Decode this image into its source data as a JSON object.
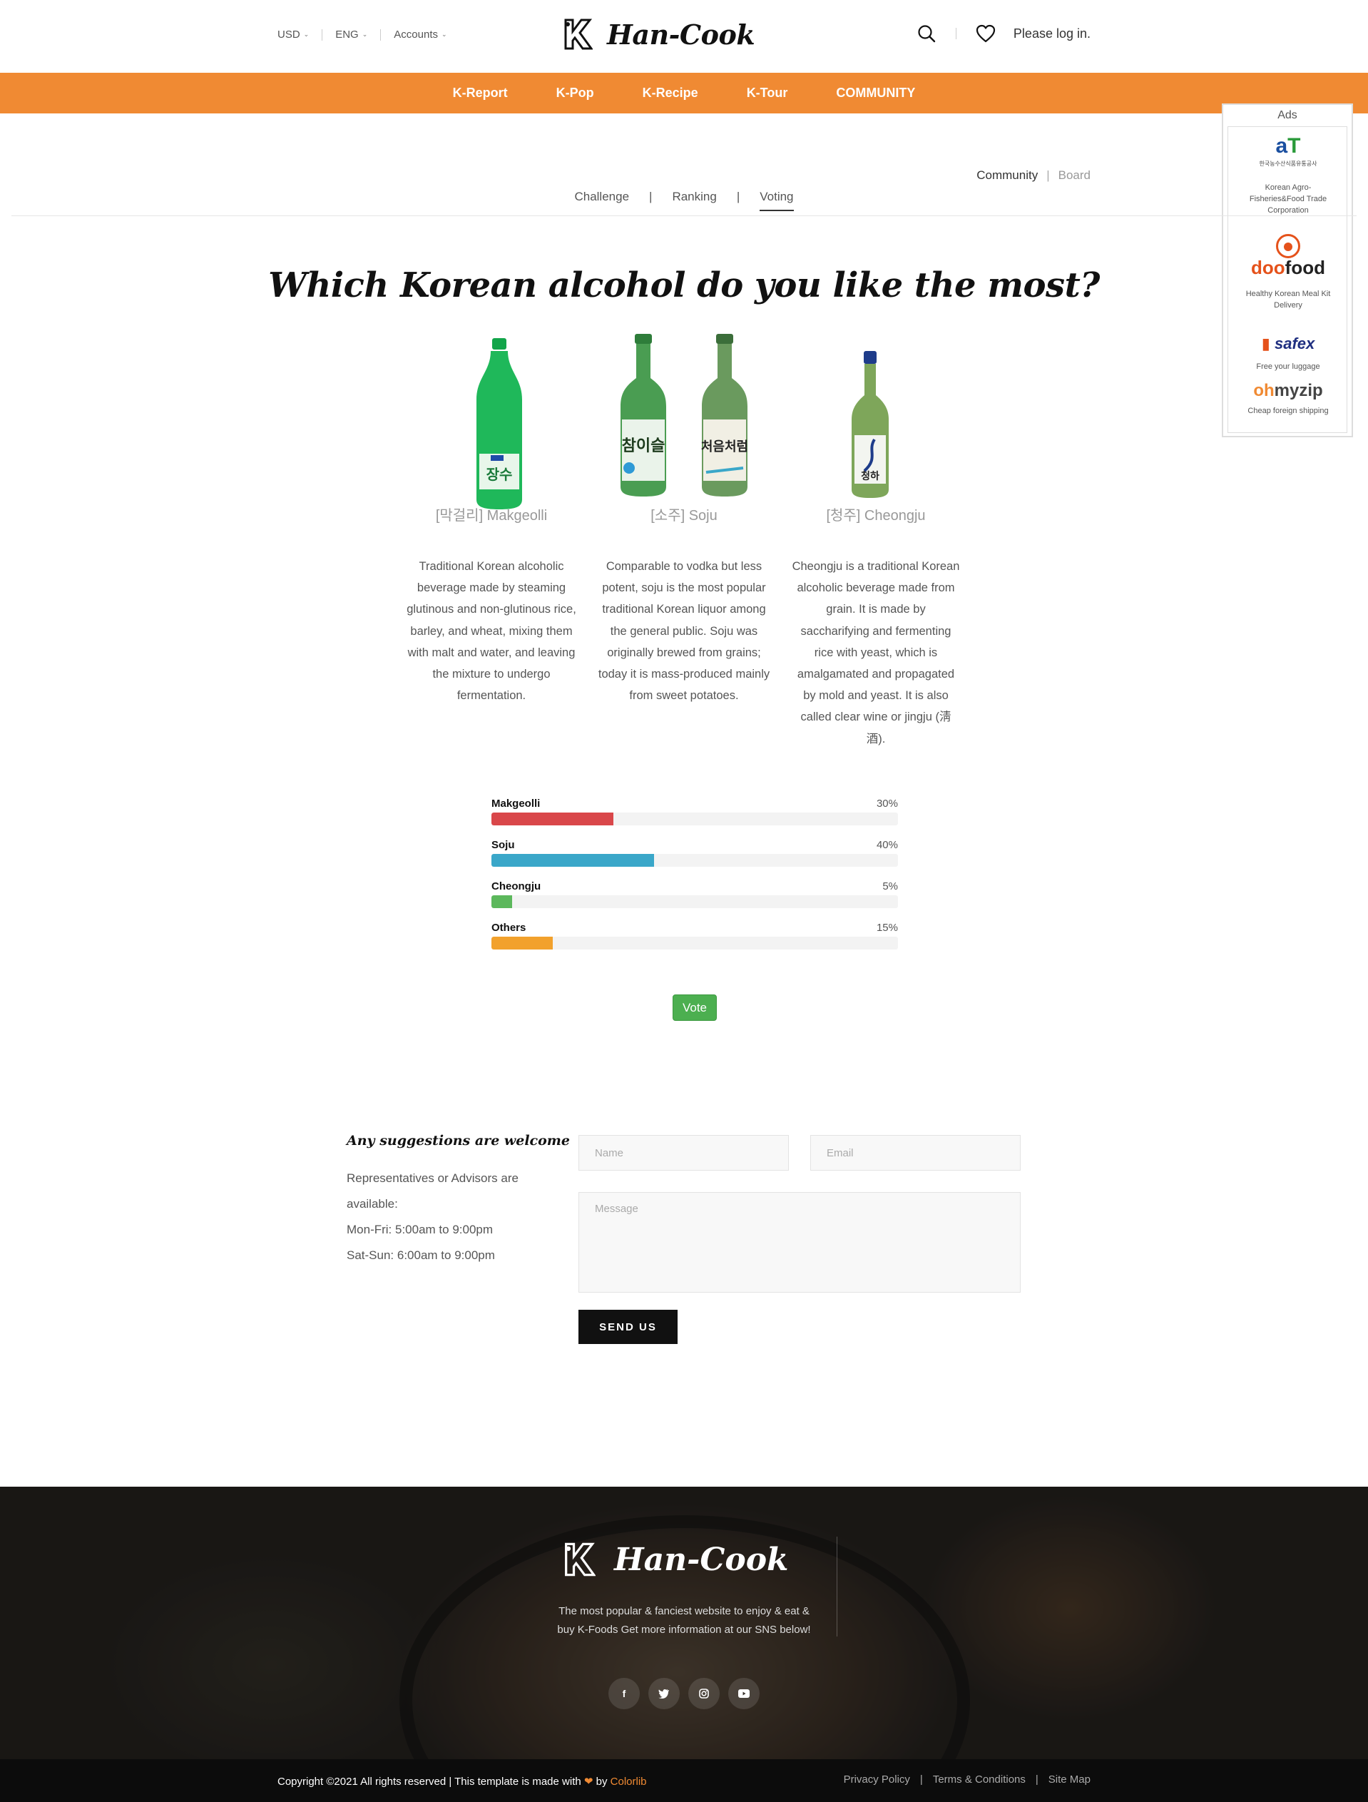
{
  "topbar": {
    "currency": "USD",
    "language": "ENG",
    "accounts": "Accounts",
    "login": "Please log in."
  },
  "brand": {
    "name": "Han-Cook",
    "accent": "#f08a33"
  },
  "nav": [
    "K-Report",
    "K-Pop",
    "K-Recipe",
    "K-Tour",
    "COMMUNITY"
  ],
  "ads": {
    "title": "Ads",
    "items": [
      {
        "logo": "aT",
        "sub": "한국농수산식품유통공사",
        "caption": "Korean Agro-Fisheries&Food Trade Corporation"
      },
      {
        "logo": "doofood",
        "caption": "Healthy Korean Meal Kit Delivery"
      },
      {
        "logo": "safex",
        "caption": "Free your luggage"
      },
      {
        "logo": "ohmyzip",
        "caption": "Cheap foreign shipping"
      }
    ]
  },
  "breadcrumb": {
    "items": [
      "Community",
      "Board"
    ]
  },
  "subnav": {
    "items": [
      "Challenge",
      "Ranking",
      "Voting"
    ],
    "active": "Voting"
  },
  "poll": {
    "question": "Which Korean alcohol do you like the most?",
    "drinks": [
      {
        "label": "[막걸리] Makgeolli",
        "bottle_text": "장수",
        "desc": "Traditional Korean alcoholic beverage made by steaming glutinous and non-glutinous rice, barley, and wheat, mixing them with malt and water, and leaving the mixture to undergo fermentation."
      },
      {
        "label": "[소주] Soju",
        "bottle_text": [
          "참이슬",
          "처음처럼"
        ],
        "desc": "Comparable to vodka but less potent, soju is the most popular traditional Korean liquor among the general public. Soju was originally brewed from grains; today it is mass-produced mainly from sweet potatoes."
      },
      {
        "label": "[청주] Cheongju",
        "bottle_text": "청하",
        "desc": "Cheongju is a traditional Korean alcoholic beverage made from grain. It is made by saccharifying and fermenting rice with yeast, which is amalgamated and propagated by mold and yeast. It is also called clear wine or jingju (淸酒)."
      }
    ],
    "results": [
      {
        "name": "Makgeolli",
        "percent": "30%",
        "value": 30,
        "color": "#d9474a"
      },
      {
        "name": "Soju",
        "percent": "40%",
        "value": 40,
        "color": "#3aa7c9"
      },
      {
        "name": "Cheongju",
        "percent": "5%",
        "value": 5,
        "color": "#5cb85c"
      },
      {
        "name": "Others",
        "percent": "15%",
        "value": 15,
        "color": "#f2a12c"
      }
    ],
    "vote_label": "Vote"
  },
  "contact": {
    "title": "Any suggestions are welcome",
    "lines": [
      "Representatives or Advisors are",
      "available:",
      "Mon-Fri: 5:00am to 9:00pm",
      "Sat-Sun: 6:00am to 9:00pm"
    ],
    "name_placeholder": "Name",
    "email_placeholder": "Email",
    "message_placeholder": "Message",
    "send_label": "SEND US"
  },
  "footer": {
    "text": "The most popular & fanciest website to enjoy & eat & buy K-Foods Get more information at our SNS below!",
    "socials": [
      "facebook-icon",
      "twitter-icon",
      "instagram-icon",
      "youtube-icon"
    ],
    "copyright_pre": "Copyright ©2021 All rights reserved | This template is made with",
    "copyright_by": "by",
    "copyright_brand": "Colorlib",
    "links": [
      "Privacy Policy",
      "Terms & Conditions",
      "Site Map"
    ]
  }
}
